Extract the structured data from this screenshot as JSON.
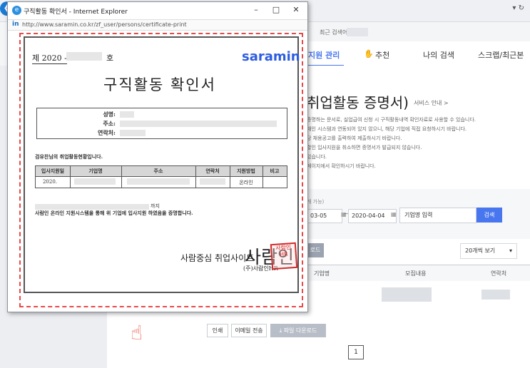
{
  "browser": {
    "refresh": "▾ ↻"
  },
  "background": {
    "recent_search_label": "최근 검색어",
    "nav": {
      "apply_manage": "지원 관리",
      "recommend": "추천",
      "my_search": "나의 검색",
      "scrap": "스크랩/최근본"
    },
    "page_title": "취업활동 증명서)",
    "guide_link": "서비스 안내 >",
    "description_lines": [
      "증명하는 문서로, 실업급여 신청 시 구직활동내역 확인자료로 사용할 수 있습니다.",
      "채인 시스템과 연동되어 있지 않으니, 해당 기업에 직접 요청하시기 바랍니다.",
      "당 채용공고를 출력하여 제출하시기 바랍니다.",
      "할인 입사지원을 취소하면 증명서가 발급되지 않습니다.",
      "있습니다.",
      "페이지에서 확인하시기 바랍니다."
    ],
    "filter_label": "개 가능)",
    "date_from": "03-05",
    "date_to": "2020-04-04",
    "date_sep": "~",
    "company_placeholder": "기업명 입력",
    "search_button": "검색",
    "download_tab": "로드",
    "per_page": "20개씩 보기",
    "col_company": "기업명",
    "col_recruit": "모집내용",
    "col_contact": "연락처",
    "btn_print": "인쇄",
    "btn_email": "이메일 전송",
    "btn_file": "파일 다운로드",
    "page_number": "1"
  },
  "popup": {
    "title": "구직활동 확인서 - Internet Explorer",
    "url": "http://www.saramin.co.kr/zf_user/persons/certificate-print",
    "minimize": "–",
    "maximize": "□",
    "close": "✕"
  },
  "certificate": {
    "number_prefix": "제 2020 -",
    "number_suffix": "호",
    "logo": "saramin",
    "title": "구직활동 확인서",
    "label_name": "성명:",
    "label_address": "주소:",
    "label_contact": "연락처:",
    "status_intro": "검유찬님의 취업활동현황입니다.",
    "table_headers": [
      "입사지원일",
      "기업명",
      "주소",
      "연락처",
      "지원방법",
      "비고"
    ],
    "row_date": "2020.",
    "row_method": "온라인",
    "date_tail": "까지",
    "cert_statement": "사람인 온라인 지원시스템을 통해 위 기업에 입사지원 하였음을 증명합니다.",
    "issuer_prefix": "사람중심 취업사이트",
    "issuer_big": "사람인",
    "issuer_corp": "(주)사람인HR",
    "stamp_text": "사람인HR"
  }
}
